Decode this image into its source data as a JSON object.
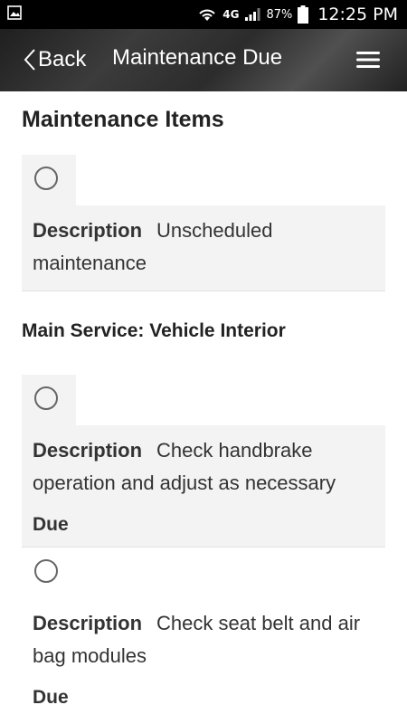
{
  "status_bar": {
    "network": "4G",
    "battery": "87%",
    "time": "12:25 PM",
    "icons": [
      "gallery-icon",
      "wifi-icon",
      "signal-icon",
      "battery-icon"
    ]
  },
  "header": {
    "back_label": "Back",
    "title": "Maintenance Due",
    "menu_icon": "hamburger-menu-icon"
  },
  "main": {
    "section_title": "Maintenance Items",
    "items": [
      {
        "label": "Description",
        "text": "Unscheduled maintenance"
      }
    ],
    "groups": [
      {
        "title": "Main Service: Vehicle Interior",
        "items": [
          {
            "label": "Description",
            "text": "Check handbrake operation and adjust as necessary",
            "due_label": "Due"
          },
          {
            "label": "Description",
            "text": "Check seat belt and air bag modules",
            "due_label": "Due"
          }
        ]
      }
    ]
  }
}
